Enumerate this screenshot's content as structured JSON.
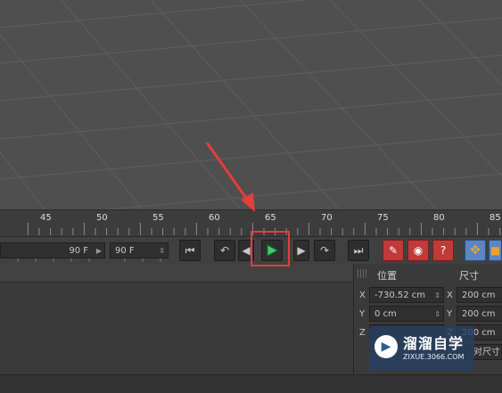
{
  "timeline": {
    "ticks": [
      "45",
      "50",
      "55",
      "60",
      "65",
      "70",
      "75",
      "80",
      "85"
    ]
  },
  "playbar": {
    "end_frame_value": "90 F",
    "preview_max_value": "90 F"
  },
  "transport_icons": {
    "go_start": "go-to-start-icon",
    "prev_key": "previous-key-icon",
    "prev_frame": "previous-frame-icon",
    "play": "play-forward-icon",
    "next_frame": "next-frame-icon",
    "next_key": "next-key-icon",
    "go_end": "go-to-end-icon",
    "record": "record-keys-icon",
    "auto_key": "autokey-icon",
    "key_selection": "keyframe-selection-icon",
    "move": "move-icon",
    "scale": "scale-icon"
  },
  "coordinates": {
    "position_header": "位置",
    "size_header": "尺寸",
    "x_label": "X",
    "y_label": "Y",
    "z_label": "Z",
    "pos_x": "-730.52 cm",
    "pos_y": "0 cm",
    "size_x": "200 cm",
    "size_y": "200 cm",
    "size_z": "200 cm",
    "size_mode": "对尺寸"
  },
  "watermark": {
    "brand": "溜溜自学",
    "site": "ZIXUE.3066.COM"
  },
  "colors": {
    "viewport_bg": "#4f4f4f",
    "grid_line": "#5d5d5d",
    "play_icon": "#3fcf6a",
    "annotation_red": "#e53c3c",
    "move_tool_active": "#f0a030"
  }
}
